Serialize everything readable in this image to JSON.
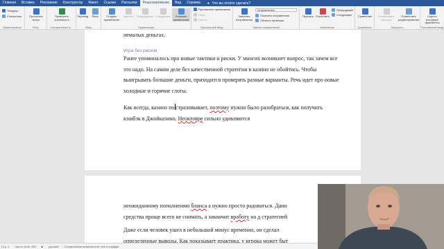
{
  "tabs": [
    "Главная",
    "Вставка",
    "Рисование",
    "Конструктор",
    "Макет",
    "Ссылки",
    "Рассылки",
    "Рецензирование",
    "Вид",
    "Справка"
  ],
  "active_tab": "Рецензирование",
  "help_search": "Что вы хотите сделать?",
  "ribbon": {
    "spelling_items": [
      "Тезаурус",
      "Статистика"
    ],
    "spelling_group": "Правописание",
    "speech_btn": "Прочитать вслух",
    "speech_group": "Речь",
    "access_btn": "Проверить читаемость",
    "access_group": "Специальные в...",
    "translate_btn": "Перевод",
    "lang_btn": "Язык",
    "lang_group": "Язык",
    "new_comment_btn": "Создать примечание",
    "delete_btn": "Удалить",
    "prev_btn": "Предыдущее",
    "next_btn": "Следующее",
    "show_comments_btn": "Показать примечания",
    "comments_group": "Примечания",
    "ink_btn": "Рукописные примечания",
    "ink_items": [
      "Перо",
      "Ластик"
    ],
    "ink_group": "Рукописный ввод",
    "track_btn": "Записать исправления",
    "markup_dropdown": "Исправления",
    "show_markup": "Показать исправления",
    "review_pane": "Область проверки",
    "tracking_group": "Запись исправлений",
    "accept_btn": "Принять",
    "reject_btn": "Отклонить",
    "prev_change": "Предыдущее",
    "next_change": "Следующее",
    "changes_group": "Изменения",
    "compare_btn": "Сравнение",
    "compare_group": "Сравнение",
    "block_btn": "Блокировать авторов",
    "restrict_btn": "Ограничить редактирование",
    "protect_group": "Защитить",
    "hide_btn": "Скрыть исходные фрагменты",
    "ink_group2": "Рукописный ввод"
  },
  "doc": {
    "top_fragment": "немалых деньгах.",
    "heading": "Игра без рисков",
    "para1": "Ранее упоминалось про новые тактики и риски. У многих возникнет вопрос, так зачем все это надо. На самом деле без качественной стратегии в казино не обойтись. Чтобы выигрывать большие деньги, приходится проверять разные варианты. Речь идет про новые холодные и горячие слоты.",
    "para2_a": "Как всегда, казино по",
    "para2_b": "страховывает,",
    "para2_err1": "поэтому",
    "para2_c": "нужно было разобраться, как получить кэшбэк в Джойказино.",
    "para2_err2": "Неоктовре",
    "para2_d": "сильно удивляются",
    "p2_line1_a": "неожиданному пополнению",
    "p2_line1_err": "бланса",
    "p2_line1_b": "а нужно просто радоваться. Данн",
    "p2_line2_a": "средства проще всего не снимать, а закончит",
    "p2_line2_err": "вработу",
    "p2_line2_b": "на д стратегией",
    "p2_line3": "Даже если человек ушел в небольшой минус временно, он сделал",
    "p2_line4": "определенные выводы. Как показывает практика, у игрока может быт"
  },
  "status": {
    "page": "Стр. 2",
    "words": "Число слов: 339",
    "language": "русский",
    "accessibility": "Специальные возможности: все в порядке"
  },
  "colors": {
    "title_bar": "#2b579a",
    "ribbon": "#f3f3f3",
    "canvas": "#e6e6e6",
    "heading": "#7f7fa8"
  }
}
